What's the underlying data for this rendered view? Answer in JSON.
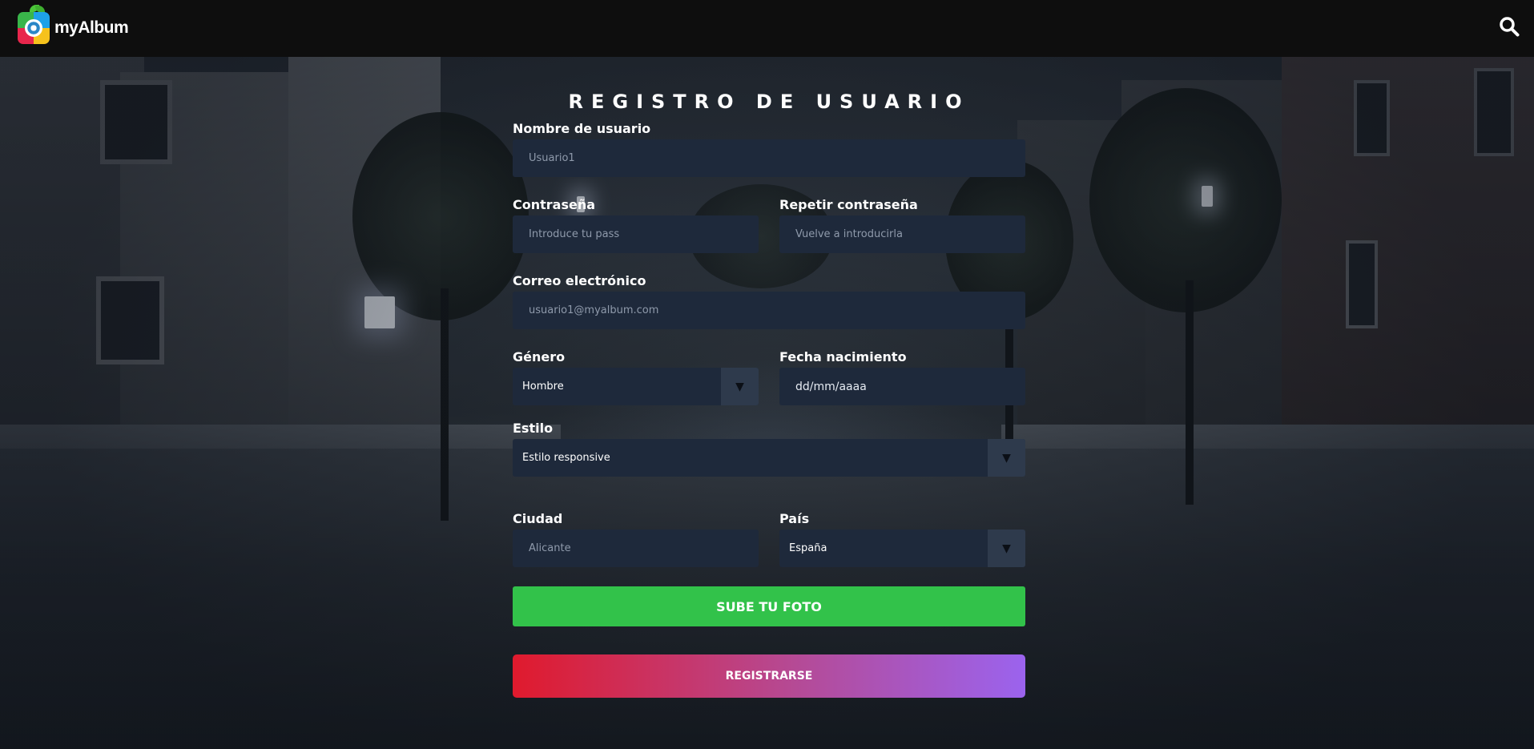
{
  "header": {
    "brand": "myAlbum",
    "search_icon": "search-icon"
  },
  "form": {
    "title": "REGISTRO DE USUARIO",
    "username": {
      "label": "Nombre de usuario",
      "placeholder": "Usuario1"
    },
    "password": {
      "label": "Contraseña",
      "placeholder": "Introduce tu pass"
    },
    "repeat_password": {
      "label": "Repetir contraseña",
      "placeholder": "Vuelve a introducirla"
    },
    "email": {
      "label": "Correo electrónico",
      "placeholder": "usuario1@myalbum.com"
    },
    "gender": {
      "label": "Género",
      "value": "Hombre"
    },
    "birthdate": {
      "label": "Fecha nacimiento",
      "value": "dd/mm/aaaa"
    },
    "style": {
      "label": "Estilo",
      "value": "Estilo responsive"
    },
    "city": {
      "label": "Ciudad",
      "placeholder": "Alicante"
    },
    "country": {
      "label": "País",
      "value": "España"
    },
    "dropdown_arrow": "▼",
    "upload_button": "SUBE TU FOTO",
    "submit_button": "REGISTRARSE"
  },
  "colors": {
    "topbar": "#0e0e0e",
    "field_bg": "#1e293b",
    "upload_green": "#32c24a",
    "register_gradient_start": "#e01a2d",
    "register_gradient_end": "#9b63ee"
  }
}
